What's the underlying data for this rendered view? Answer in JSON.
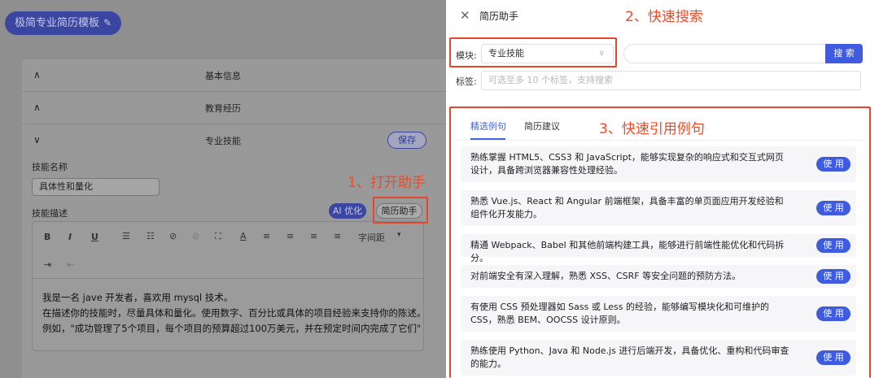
{
  "editor": {
    "title": "极简专业简历模板",
    "edit_icon": "✎",
    "sections": [
      {
        "label": "基本信息",
        "chevron": "∧"
      },
      {
        "label": "教育经历",
        "chevron": "∧"
      },
      {
        "label": "专业技能",
        "chevron": "∨"
      }
    ],
    "save_label": "保存",
    "skill_name_label": "技能名称",
    "skill_name_value": "具体性和量化",
    "skill_desc_label": "技能描述",
    "ai_label": "AI 优化",
    "helper_label": "简历助手",
    "toolbar": {
      "bold": "B",
      "italic": "I",
      "underline": "U",
      "ul": "☰",
      "ol": "☷",
      "link": "⊘",
      "unlink": "⊘",
      "code": "⛶",
      "color": "A",
      "align_left": "≡",
      "align_center": "≡",
      "align_right": "≡",
      "justify": "≡",
      "line_spacing": "字间距",
      "dropdown": "▾",
      "indent": "⇥",
      "outdent": "⇤"
    },
    "content_lines": [
      "我是一名 jave 开发者，喜欢用 mysql 技术。",
      "在描述你的技能时，尽量具体和量化。使用数字、百分比或具体的项目经验来支持你的陈述。",
      "例如，\"成功管理了5个项目，每个项目的预算超过100万美元，并在预定时间内完成了它们\""
    ]
  },
  "annotations": {
    "step1": "1、打开助手",
    "step2": "2、快速搜索",
    "step3": "3、快速引用例句"
  },
  "drawer": {
    "close_icon": "✕",
    "title": "简历助手",
    "module_label": "模块:",
    "module_value": "专业技能",
    "module_arrow": "∨",
    "search_placeholder": "",
    "search_button": "搜 索",
    "tags_label": "标签:",
    "tags_placeholder": "可选至多 10 个标签，支持搜索",
    "tabs": [
      "精选例句",
      "简历建议"
    ],
    "use_label": "使 用",
    "examples": [
      "熟练掌握 HTML5、CSS3 和 JavaScript，能够实现复杂的响应式和交互式网页设计，具备跨浏览器兼容性处理经验。",
      "熟悉 Vue.js、React 和 Angular 前端框架，具备丰富的单页面应用开发经验和组件化开发能力。",
      "精通 Webpack、Babel 和其他前端构建工具，能够进行前端性能优化和代码拆分。",
      "对前端安全有深入理解，熟悉 XSS、CSRF 等安全问题的预防方法。",
      "有使用 CSS 预处理器如 Sass 或 Less 的经验，能够编写模块化和可维护的 CSS，熟悉 BEM、OOCSS 设计原则。",
      "熟练使用 Python、Java 和 Node.js 进行后端开发，具备优化、重构和代码审查的能力。"
    ]
  },
  "colors": {
    "accent": "#3f5be0",
    "annotation_red": "#e8452c",
    "overlay_gray": "#8f8f8f"
  }
}
